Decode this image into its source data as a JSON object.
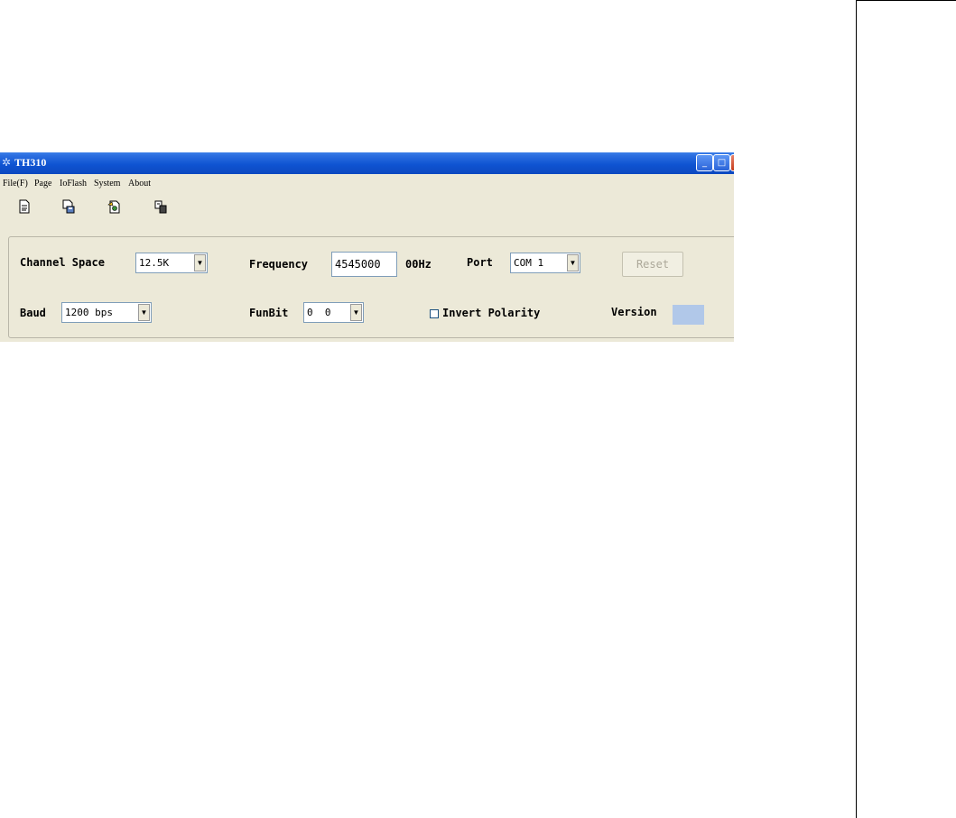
{
  "window": {
    "title": "TH310",
    "controls": {
      "minimize": "_",
      "maximize": "□",
      "close": "×"
    }
  },
  "menu": [
    "File(F)",
    "Page",
    "IoFlash",
    "System",
    "About"
  ],
  "toolbar": {
    "icons": [
      "new-document-icon",
      "save-document-icon",
      "open-document-icon",
      "copy-icon"
    ]
  },
  "settings": {
    "channel_space": {
      "label": "Channel Space",
      "value": "12.5K"
    },
    "frequency": {
      "label": "Frequency",
      "value": "4545000",
      "unit": "00Hz"
    },
    "port": {
      "label": "Port",
      "value": "COM 1"
    },
    "reset_label": "Reset",
    "baud": {
      "label": "Baud",
      "value": "1200 bps"
    },
    "funbit": {
      "label": "FunBit",
      "value": "0  0"
    },
    "invert_polarity_label": "Invert Polarity",
    "version_label": "Version"
  },
  "colors": {
    "titlebar": "#0f54d2",
    "window_bg": "#ece9d8",
    "version_box": "#b1c8e9"
  }
}
